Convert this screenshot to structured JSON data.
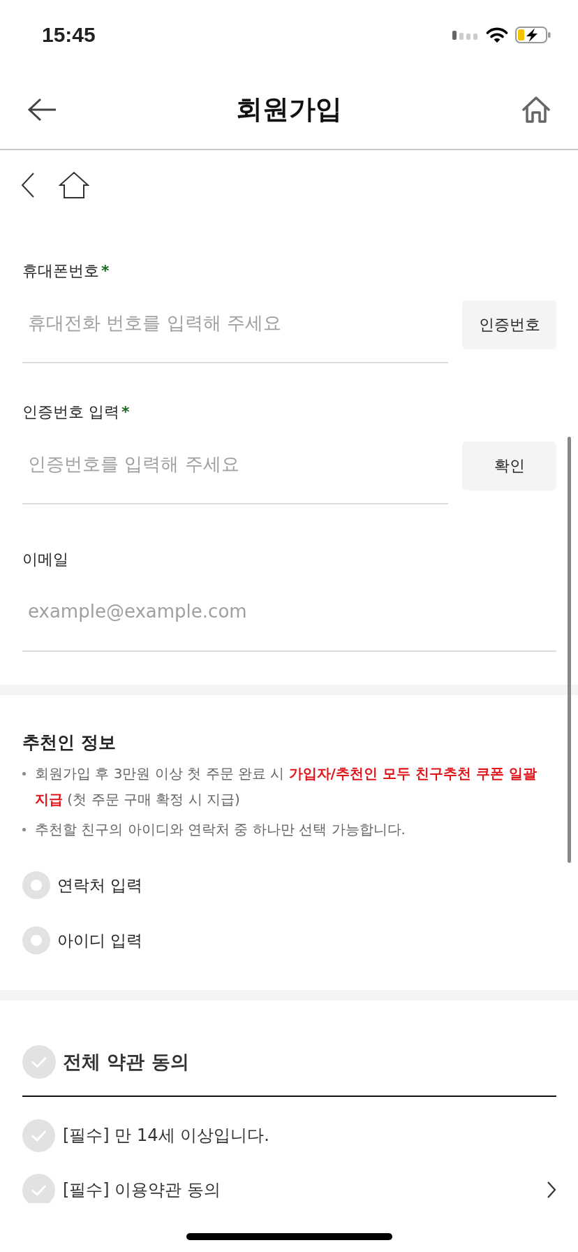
{
  "status_bar": {
    "time": "15:45"
  },
  "header": {
    "title": "회원가입"
  },
  "form": {
    "fields": [
      {
        "label": "휴대폰번호",
        "required_mark": "*",
        "placeholder": "휴대전화 번호를 입력해 주세요",
        "button": "인증번호"
      },
      {
        "label": "인증번호 입력",
        "required_mark": "*",
        "placeholder": "인증번호를 입력해 주세요",
        "button": "확인"
      },
      {
        "label": "이메일",
        "placeholder": "example@example.com"
      }
    ]
  },
  "referral": {
    "title": "추천인 정보",
    "notes": [
      "회원가입 후 3만원 이상 첫 주문 완료 시 **가입자/추천인 모두 친구추천 쿠폰 일괄 지급** (첫 주문 구매 확정 시 지급)",
      "추천할 친구의 아이디와 연락처 중 하나만 선택 가능합니다."
    ],
    "options": [
      {
        "label": "연락처 입력",
        "selected": false
      },
      {
        "label": "아이디 입력",
        "selected": false
      }
    ]
  },
  "terms": {
    "all": {
      "label": "전체 약관 동의",
      "checked": false
    },
    "items": [
      {
        "label": "[필수] 만 14세 이상입니다.",
        "checked": false,
        "has_detail": false
      },
      {
        "label": "[필수] 이용약관 동의",
        "checked": false,
        "has_detail": true
      }
    ]
  }
}
